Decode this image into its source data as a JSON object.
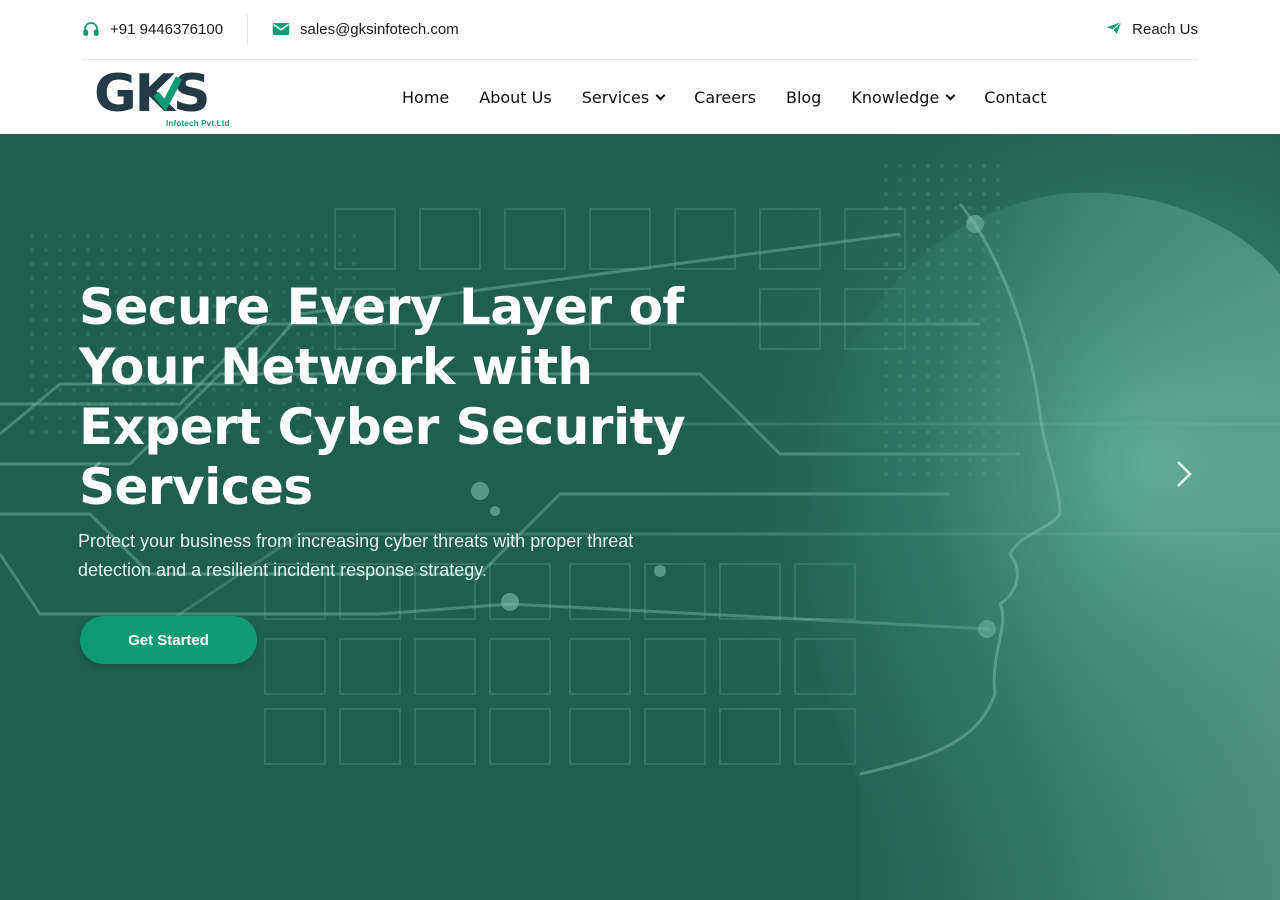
{
  "topbar": {
    "phone": "+91 9446376100",
    "email": "sales@gksinfotech.com",
    "reach_label": "Reach Us"
  },
  "logo": {
    "main": "GKS",
    "sub": "Infotech Pvt.Ltd"
  },
  "nav": {
    "items": [
      {
        "label": "Home"
      },
      {
        "label": "About Us"
      },
      {
        "label": "Services"
      },
      {
        "label": "Careers"
      },
      {
        "label": "Blog"
      },
      {
        "label": "Knowledge"
      },
      {
        "label": "Contact"
      }
    ]
  },
  "hero": {
    "title_lines": [
      "Secure Every Layer of",
      "Your Network with",
      "Expert Cyber Security",
      "Services"
    ],
    "description_lines": [
      "Protect your business from increasing cyber threats with proper threat",
      "detection and a resilient incident response strategy."
    ],
    "cta_label": "Get Started"
  },
  "colors": {
    "accent": "#0f9b72",
    "hero_bg": "#1f5f4e",
    "logo_dark": "#233b47"
  },
  "icons": {
    "phone": "headset-icon",
    "email": "envelope-icon",
    "reach": "paper-plane-icon",
    "prev": "chevron-left-icon",
    "next": "chevron-right-icon"
  }
}
